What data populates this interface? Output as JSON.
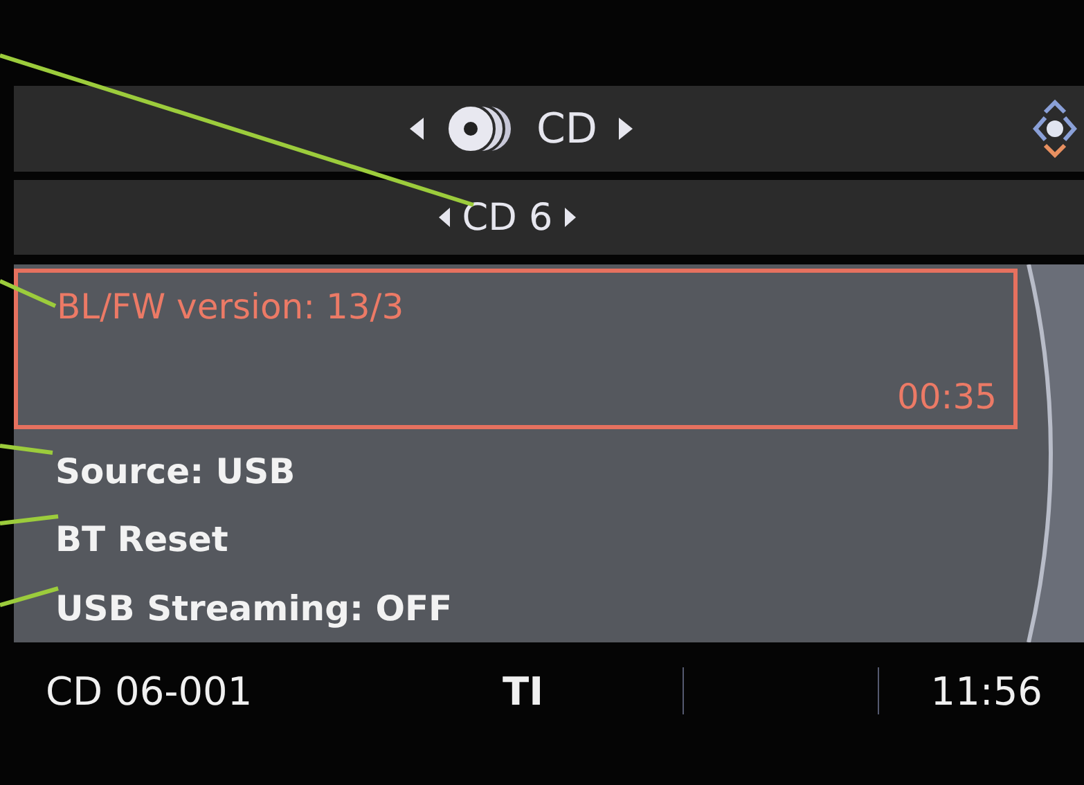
{
  "header": {
    "source": "CD"
  },
  "subheader": {
    "disc": "CD 6"
  },
  "menu": [
    {
      "label": "BL/FW version: 13/3",
      "time": "00:35",
      "selected": true
    },
    {
      "label": "Source: USB",
      "selected": false
    },
    {
      "label": "BT Reset",
      "selected": false
    },
    {
      "label": "USB Streaming: OFF",
      "selected": false
    }
  ],
  "status_bar": {
    "track": "CD 06-001",
    "ti": "TI",
    "clock": "11:56"
  }
}
